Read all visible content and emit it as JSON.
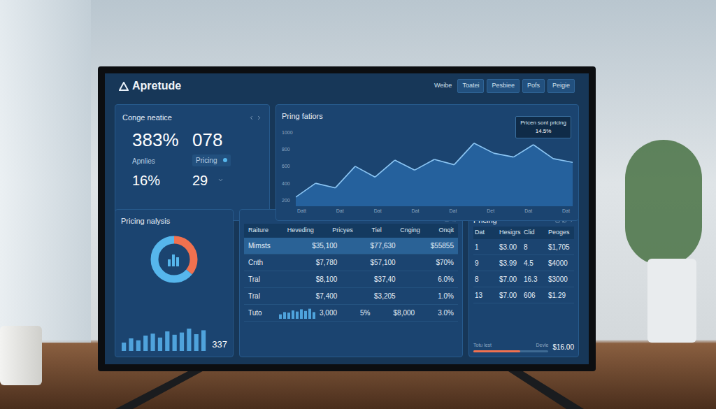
{
  "app": {
    "logo": "Apretude",
    "nav": [
      {
        "label": "Weibe",
        "kind": "link"
      },
      {
        "label": "Toatei",
        "kind": "button"
      },
      {
        "label": "Pesbiee",
        "kind": "button"
      },
      {
        "label": "Pofs",
        "kind": "button"
      },
      {
        "label": "Peigie",
        "kind": "button"
      }
    ]
  },
  "summary": {
    "title": "Conge neatice",
    "primary": [
      {
        "value": "383%",
        "label": "Apnlies"
      },
      {
        "value": "078",
        "label": "Pricing",
        "selected": true
      }
    ],
    "secondary": [
      {
        "value": "16%"
      },
      {
        "value": "29"
      }
    ]
  },
  "trend_chart": {
    "title": "Pring fatiors",
    "y_ticks": [
      "1000",
      "800",
      "600",
      "400",
      "200"
    ],
    "x_labels": [
      "Datt",
      "Dat",
      "Dat",
      "Dat",
      "Dat",
      "Det",
      "Dat",
      "Dat"
    ],
    "series": [
      120,
      300,
      240,
      520,
      380,
      600,
      470,
      610,
      540,
      820,
      690,
      640,
      800,
      620,
      570
    ],
    "tooltip": {
      "label": "Pricen sont pricing",
      "value": "14.5%"
    }
  },
  "analysis": {
    "title": "Pricing nalysis",
    "donut": [
      {
        "level": 0.36,
        "color": "#f0714f"
      },
      {
        "level": 0.64,
        "color": "#56b6ec"
      }
    ],
    "bars": [
      30,
      45,
      38,
      55,
      62,
      48,
      70,
      58,
      66,
      80,
      60,
      74
    ],
    "count": "337"
  },
  "table": {
    "columns": [
      "Raiture",
      "Heveding",
      "Pricyes",
      "Tiel",
      "Cnging",
      "Onqit"
    ],
    "rows": [
      {
        "kind": "plain",
        "label": "Mimsts",
        "selected": true,
        "cells": [
          "$35,100",
          "$77,630",
          "$55855"
        ]
      },
      {
        "kind": "plain",
        "label": "Cnth",
        "selected": false,
        "cells": [
          "$7,780",
          "$57,100",
          "$70%"
        ]
      },
      {
        "kind": "plain",
        "label": "Tral",
        "selected": false,
        "cells": [
          "$8,100",
          "$37,40",
          "6.0%"
        ]
      },
      {
        "kind": "plain",
        "label": "Tral",
        "selected": false,
        "cells": [
          "$7,400",
          "$3,205",
          "1.0%"
        ]
      },
      {
        "kind": "bars",
        "label": "Tuto",
        "selected": false,
        "bars": [
          40,
          60,
          55,
          75,
          65,
          85,
          70,
          90,
          60
        ],
        "cells": [
          "3,000",
          "5%",
          "$8,000",
          "3.0%"
        ]
      }
    ]
  },
  "pricing": {
    "title": "Pricing",
    "columns": [
      "Dat",
      "Hesigrs",
      "Clid",
      "Peoges"
    ],
    "rows": [
      [
        "1",
        "$3.00",
        "8",
        "$1,705"
      ],
      [
        "9",
        "$3.99",
        "4.5",
        "$4000"
      ],
      [
        "8",
        "$7.00",
        "16.3",
        "$3000"
      ],
      [
        "13",
        "$7.00",
        "606",
        "$1.29"
      ]
    ],
    "footer": {
      "label": "Totu lest",
      "note": "Devle",
      "level": 0.62,
      "value": "$16.00"
    }
  }
}
